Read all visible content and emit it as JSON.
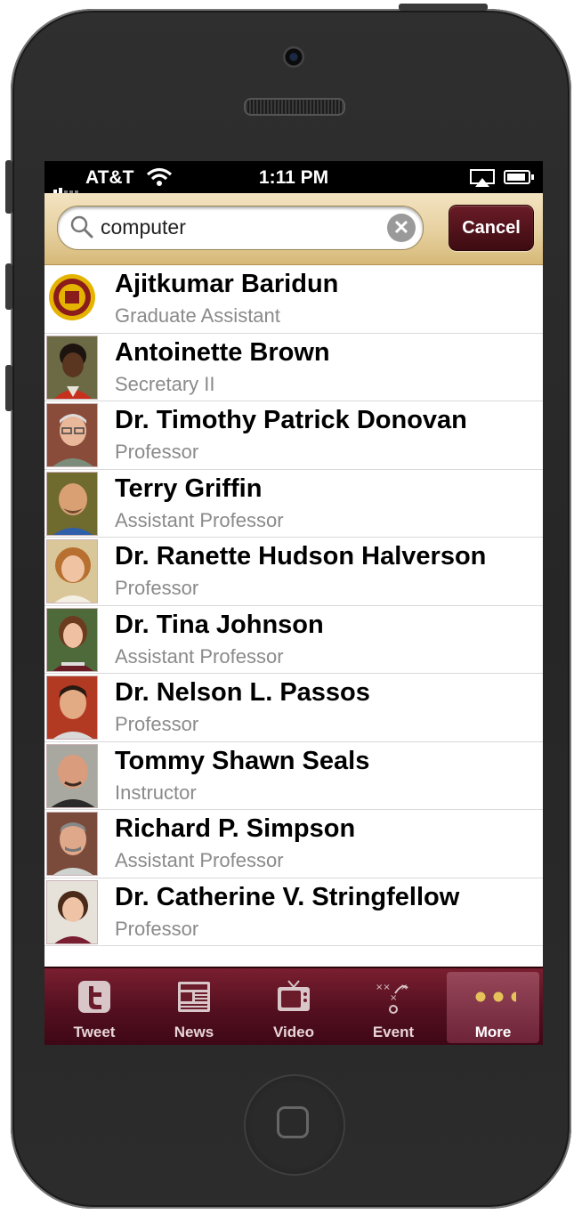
{
  "status": {
    "carrier": "AT&T",
    "time": "1:11 PM"
  },
  "search": {
    "query": "computer",
    "cancel_label": "Cancel"
  },
  "results": [
    {
      "name": "Ajitkumar Baridun",
      "title": "Graduate Assistant",
      "photo": "seal"
    },
    {
      "name": "Antoinette Brown",
      "title": "Secretary II",
      "photo": "woman-dark"
    },
    {
      "name": "Dr. Timothy Patrick Donovan",
      "title": "Professor",
      "photo": "man-glasses"
    },
    {
      "name": "Terry Griffin",
      "title": "Assistant Professor",
      "photo": "man-goatee"
    },
    {
      "name": "Dr. Ranette Hudson Halverson",
      "title": "Professor",
      "photo": "woman-blonde"
    },
    {
      "name": "Dr. Tina Johnson",
      "title": "Assistant Professor",
      "photo": "woman-brunette"
    },
    {
      "name": "Dr. Nelson L. Passos",
      "title": "Professor",
      "photo": "man-dark-hair"
    },
    {
      "name": "Tommy Shawn Seals",
      "title": "Instructor",
      "photo": "man-bald"
    },
    {
      "name": "Richard P. Simpson",
      "title": "Assistant Professor",
      "photo": "man-mustache"
    },
    {
      "name": "Dr. Catherine V. Stringfellow",
      "title": "Professor",
      "photo": "woman-short-hair"
    }
  ],
  "tabs": [
    {
      "label": "Tweet",
      "icon": "twitter-icon"
    },
    {
      "label": "News",
      "icon": "newspaper-icon"
    },
    {
      "label": "Video",
      "icon": "tv-icon"
    },
    {
      "label": "Event",
      "icon": "playbook-icon"
    },
    {
      "label": "More",
      "icon": "more-dots-icon",
      "active": true
    }
  ],
  "colors": {
    "maroon": "#5a1223",
    "gold": "#e7d09f"
  }
}
